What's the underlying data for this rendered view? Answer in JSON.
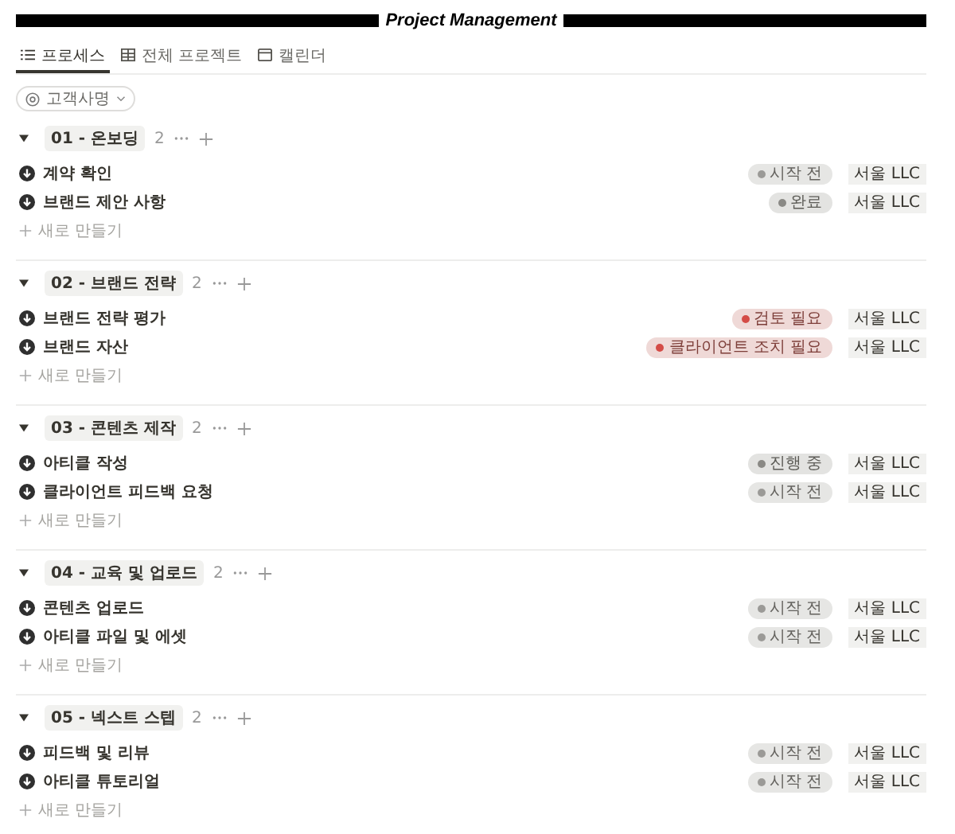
{
  "title": "Project Management",
  "tabs": [
    {
      "label": "프로세스",
      "selected": true
    },
    {
      "label": "전체 프로젝트",
      "selected": false
    },
    {
      "label": "캘린더",
      "selected": false
    }
  ],
  "filter": {
    "label": "고객사명"
  },
  "groups": [
    {
      "name": "01 - 온보딩",
      "count": "2",
      "expanded": true,
      "new_label": "새로 만들기",
      "items": [
        {
          "title": "계약 확인",
          "status": {
            "label": "시작 전",
            "color": "#9b9a97"
          },
          "client": "서울 LLC"
        },
        {
          "title": "브랜드 제안 사항",
          "status": {
            "label": "완료",
            "color": "#8a8985"
          },
          "client": "서울 LLC"
        }
      ]
    },
    {
      "name": "02 - 브랜드 전략",
      "count": "2",
      "expanded": true,
      "new_label": "새로 만들기",
      "items": [
        {
          "title": "브랜드 전략 평가",
          "status": {
            "label": "검토 필요",
            "color": "#d44c47"
          },
          "client": "서울 LLC"
        },
        {
          "title": "브랜드 자산",
          "status": {
            "label": "클라이언트 조치 필요",
            "color": "#d44c47"
          },
          "client": "서울 LLC"
        }
      ]
    },
    {
      "name": "03 - 콘텐츠 제작",
      "count": "2",
      "expanded": true,
      "new_label": "새로 만들기",
      "items": [
        {
          "title": "아티클 작성",
          "status": {
            "label": "진행 중",
            "color": "#8a8985"
          },
          "client": "서울 LLC"
        },
        {
          "title": "클라이언트 피드백 요청",
          "status": {
            "label": "시작 전",
            "color": "#9b9a97"
          },
          "client": "서울 LLC"
        }
      ]
    },
    {
      "name": "04 - 교육 및 업로드",
      "count": "2",
      "expanded": true,
      "new_label": "새로 만들기",
      "items": [
        {
          "title": "콘텐츠 업로드",
          "status": {
            "label": "시작 전",
            "color": "#9b9a97"
          },
          "client": "서울 LLC"
        },
        {
          "title": "아티클 파일 및 에셋",
          "status": {
            "label": "시작 전",
            "color": "#9b9a97"
          },
          "client": "서울 LLC"
        }
      ]
    },
    {
      "name": "05 - 넥스트 스텝",
      "count": "2",
      "expanded": true,
      "new_label": "새로 만들기",
      "items": [
        {
          "title": "피드백 및 리뷰",
          "status": {
            "label": "시작 전",
            "color": "#9b9a97"
          },
          "client": "서울 LLC"
        },
        {
          "title": "아티클 튜토리얼",
          "status": {
            "label": "시작 전",
            "color": "#9b9a97"
          },
          "client": "서울 LLC"
        }
      ]
    }
  ]
}
